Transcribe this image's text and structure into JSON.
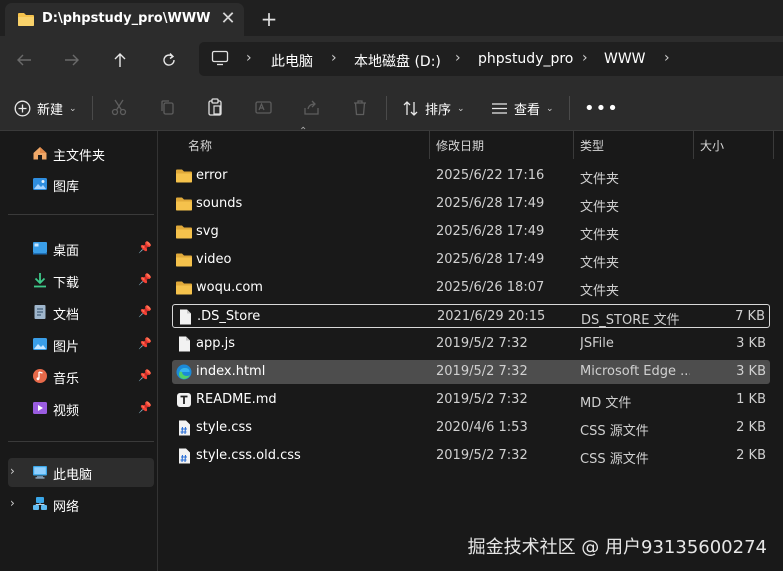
{
  "window": {
    "tab_title": "D:\\phpstudy_pro\\WWW"
  },
  "breadcrumb": [
    "此电脑",
    "本地磁盘 (D:)",
    "phpstudy_pro",
    "WWW"
  ],
  "toolbar": {
    "new_label": "新建",
    "sort_label": "排序",
    "view_label": "查看"
  },
  "sidebar": {
    "top": [
      {
        "label": "主文件夹",
        "icon": "home-icon"
      },
      {
        "label": "图库",
        "icon": "gallery-icon"
      }
    ],
    "pinned": [
      {
        "label": "桌面",
        "icon": "desktop-icon"
      },
      {
        "label": "下载",
        "icon": "download-icon"
      },
      {
        "label": "文档",
        "icon": "documents-icon"
      },
      {
        "label": "图片",
        "icon": "pictures-icon"
      },
      {
        "label": "音乐",
        "icon": "music-icon"
      },
      {
        "label": "视频",
        "icon": "videos-icon"
      }
    ],
    "locations": [
      {
        "label": "此电脑",
        "icon": "this-pc-icon"
      },
      {
        "label": "网络",
        "icon": "network-icon"
      }
    ]
  },
  "columns": {
    "name": "名称",
    "date": "修改日期",
    "type": "类型",
    "size": "大小"
  },
  "files": [
    {
      "name": "error",
      "date": "2025/6/22 17:16",
      "type": "文件夹",
      "size": "",
      "icon": "folder-icon"
    },
    {
      "name": "sounds",
      "date": "2025/6/28 17:49",
      "type": "文件夹",
      "size": "",
      "icon": "folder-icon"
    },
    {
      "name": "svg",
      "date": "2025/6/28 17:49",
      "type": "文件夹",
      "size": "",
      "icon": "folder-icon"
    },
    {
      "name": "video",
      "date": "2025/6/28 17:49",
      "type": "文件夹",
      "size": "",
      "icon": "folder-icon"
    },
    {
      "name": "woqu.com",
      "date": "2025/6/26 18:07",
      "type": "文件夹",
      "size": "",
      "icon": "folder-icon"
    },
    {
      "name": ".DS_Store",
      "date": "2021/6/29 20:15",
      "type": "DS_STORE 文件",
      "size": "7 KB",
      "icon": "file-icon"
    },
    {
      "name": "app.js",
      "date": "2019/5/2 7:32",
      "type": "JSFile",
      "size": "3 KB",
      "icon": "file-icon"
    },
    {
      "name": "index.html",
      "date": "2019/5/2 7:32",
      "type": "Microsoft Edge ...",
      "size": "3 KB",
      "icon": "edge-icon"
    },
    {
      "name": "README.md",
      "date": "2019/5/2 7:32",
      "type": "MD 文件",
      "size": "1 KB",
      "icon": "text-file-icon"
    },
    {
      "name": "style.css",
      "date": "2020/4/6 1:53",
      "type": "CSS 源文件",
      "size": "2 KB",
      "icon": "css-file-icon"
    },
    {
      "name": "style.css.old.css",
      "date": "2019/5/2 7:32",
      "type": "CSS 源文件",
      "size": "2 KB",
      "icon": "css-file-icon"
    }
  ],
  "watermark": "掘金技术社区 @ 用户93135600274",
  "colors": {
    "folder": "#f5c24c",
    "background": "#191919",
    "chrome": "#2c2c2c",
    "hover": "#4d4d4d"
  }
}
